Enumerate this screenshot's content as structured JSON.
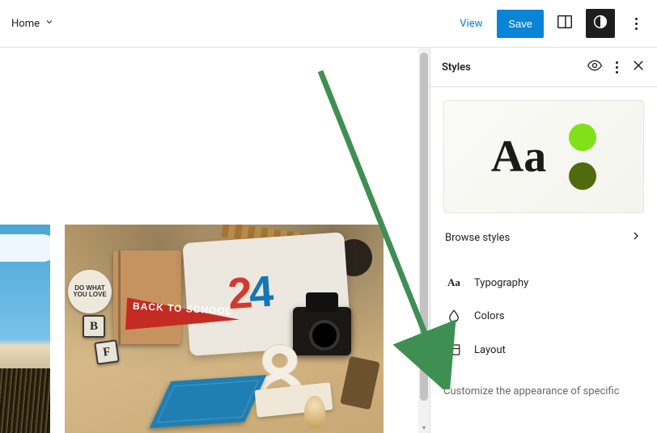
{
  "toolbar": {
    "page_name": "Home",
    "view_label": "View",
    "save_label": "Save"
  },
  "panel": {
    "title": "Styles",
    "preview_sample": "Aa",
    "swatch_colors": {
      "primary": "#80e019",
      "secondary": "#4f6b0d"
    },
    "browse_label": "Browse styles",
    "items": [
      {
        "key": "typography",
        "label": "Typography"
      },
      {
        "key": "colors",
        "label": "Colors"
      },
      {
        "key": "layout",
        "label": "Layout"
      }
    ],
    "customize_hint": "Customize the appearance of specific"
  },
  "gallery": {
    "tshirt_number_parts": [
      "2",
      "4"
    ],
    "pennant_text": "BACK TO SCHOOL",
    "love_sign": "DO WHAT YOU LOVE",
    "letter_blocks": [
      "B",
      "F"
    ]
  }
}
